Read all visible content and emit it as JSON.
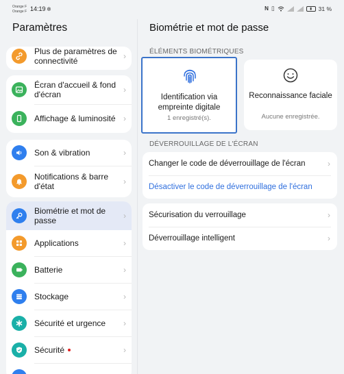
{
  "status": {
    "carrier_1": "Orange F",
    "carrier_2": "Orange F",
    "time": "14:19",
    "battery": "31 %"
  },
  "left": {
    "title": "Paramètres",
    "items": [
      {
        "label": "Plus de paramètres de connectivité",
        "icon": "link-icon",
        "color": "#f39a2c"
      },
      {
        "label": "Écran d'accueil & fond d'écran",
        "icon": "image-icon",
        "color": "#3bb25c"
      },
      {
        "label": "Affichage & luminosité",
        "icon": "phone-icon",
        "color": "#3bb25c"
      },
      {
        "label": "Son & vibration",
        "icon": "speaker-icon",
        "color": "#2f7fee"
      },
      {
        "label": "Notifications & barre d'état",
        "icon": "bell-icon",
        "color": "#f39a2c"
      },
      {
        "label": "Biométrie et mot de passe",
        "icon": "key-icon",
        "color": "#2f7fee"
      },
      {
        "label": "Applications",
        "icon": "apps-icon",
        "color": "#f39a2c"
      },
      {
        "label": "Batterie",
        "icon": "battery-icon",
        "color": "#3bb25c"
      },
      {
        "label": "Stockage",
        "icon": "storage-icon",
        "color": "#2f7fee"
      },
      {
        "label": "Sécurité et urgence",
        "icon": "asterisk-icon",
        "color": "#1ab0a8"
      },
      {
        "label": "Sécurité",
        "icon": "shield-icon",
        "color": "#1ab0a8"
      }
    ]
  },
  "right": {
    "title": "Biométrie et mot de passe",
    "section_bio": "ÉLÉMENTS BIOMÉTRIQUES",
    "fingerprint": {
      "title": "Identification via empreinte digitale",
      "sub": "1 enregistré(s)."
    },
    "face": {
      "title": "Reconnaissance faciale",
      "sub": "Aucune enregistrée."
    },
    "section_unlock": "DÉVERROUILLAGE DE L'ÉCRAN",
    "change_code": "Changer le code de déverrouillage de l'écran",
    "disable_code": "Désactiver le code de déverrouillage de l'écran",
    "secure_lock": "Sécurisation du verrouillage",
    "smart_unlock": "Déverrouillage intelligent"
  },
  "colors": {
    "accent": "#2f6fde",
    "selected_bg": "#e4e9f6",
    "highlight_border": "#3a73c9"
  }
}
